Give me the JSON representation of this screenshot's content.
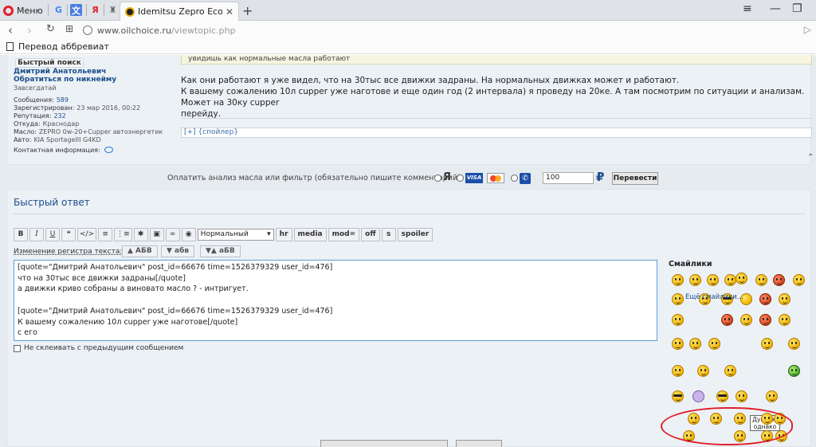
{
  "browser": {
    "menu_label": "Меню",
    "tab_title": "Idemitsu Zepro Eco Meda",
    "url_host": "www.oilchoice.ru",
    "url_path": "/viewtopic.php",
    "bookmark_label": "Перевод аббревиат"
  },
  "post": {
    "quick_search": "Быстрый поиск",
    "author_name": "Дмитрий Анатольевич",
    "author_link": "Обратиться по никнейму",
    "author_rank": "Завсегдатай",
    "profile": [
      {
        "k": "Сообщения:",
        "v": "589",
        "link": true
      },
      {
        "k": "Зарегистрирован:",
        "v": "23 мар 2016, 00:22",
        "link": false
      },
      {
        "k": "Репутация:",
        "v": "232",
        "link": true
      },
      {
        "k": "Откуда:",
        "v": "Краснодар",
        "link": false
      },
      {
        "k": "Масло:",
        "v": "ZEPRO 0w-20+Cupper автоэнергетик",
        "link": false
      },
      {
        "k": "Авто:",
        "v": "KIA SportageIII G4KD",
        "link": false
      }
    ],
    "contact_label": "Контактная информация:",
    "quote_strip": "увидишь как нормальные масла работают",
    "body_lines": [
      "Как они работают я уже видел, что на 30тыс все движки задраны. На нормальных движках может и работают.",
      "К вашему сожалению 10л cupper уже наготове и еще один год (2 интервала) я проведу на 20ке. А там посмотрим по ситуации и анализам. Может на 30ку cupper",
      "перейду."
    ],
    "spoiler": "[+] {спойлер}"
  },
  "payment": {
    "label": "Оплатить анализ масла или фильтр (обязательно пишите комментарий)",
    "ya": "Я",
    "visa": "VISA",
    "amount": "100",
    "currency": "₽",
    "convert_button": "Перевести"
  },
  "quick_reply": {
    "title": "Быстрый ответ",
    "toolbar": [
      "B",
      "I",
      "U",
      "❝",
      "</>",
      "≡",
      "⋮≡",
      "✱",
      "▣",
      "∞",
      "◉"
    ],
    "font_size": "Нормальный",
    "text_buttons": [
      "hr",
      "media",
      "mod=",
      "off",
      "s",
      "spoiler"
    ],
    "case_label": "Изменение регистра текста:",
    "case_buttons": [
      "▲ АБВ",
      "▼ абв",
      "▼▲ аБВ"
    ],
    "editor_text": "[quote=\"Дмитрий Анатольевич\" post_id=66676 time=1526379329 user_id=476]\nчто на 30тыс все движки задраны[/quote]\nа движки криво собраны а виновато масло ? - интригует.\n\n[quote=\"Дмитрий Анатольевич\" post_id=66676 time=1526379329 user_id=476]\nК вашему сожалению 10л cupper уже наготове[/quote]\nс его",
    "no_merge": "Не склеивать с предыдущим сообщением",
    "smileys_title": "Смайлики",
    "sign_text": "Дундук, однако",
    "more_smileys": "Ещё смайлики..."
  }
}
